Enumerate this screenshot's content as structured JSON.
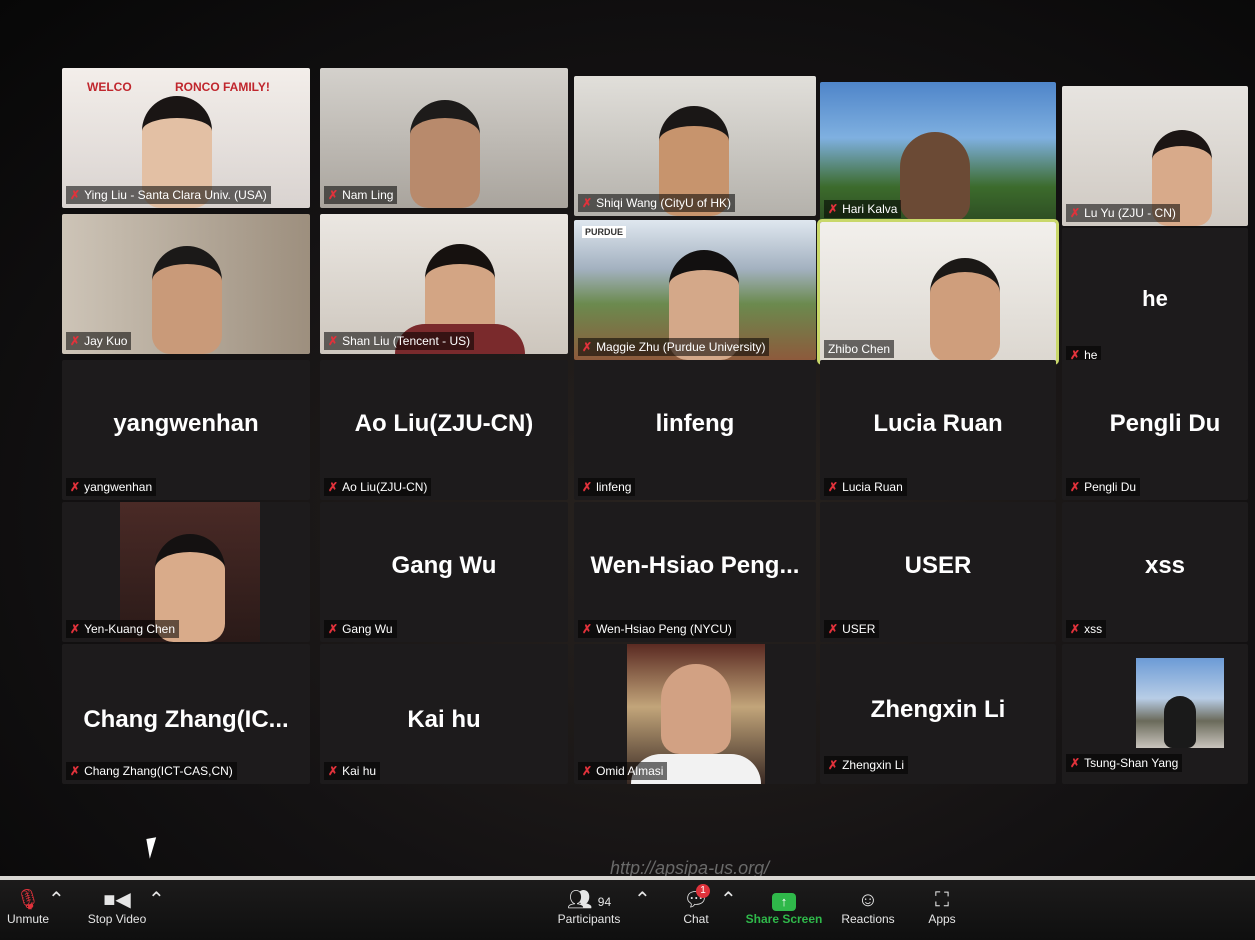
{
  "app": {
    "name": "Zoom meeting"
  },
  "tiles": [
    {
      "name": "Ying Liu - Santa Clara Univ. (USA)",
      "banner": "WELCO             RONCO FAMILY!"
    },
    {
      "name": "Nam Ling"
    },
    {
      "name": "Shiqi Wang (CityU of HK)"
    },
    {
      "name": "Hari Kalva"
    },
    {
      "name": "Lu Yu (ZJU - CN)"
    },
    {
      "name": "Jay Kuo"
    },
    {
      "name": "Shan Liu (Tencent - US)"
    },
    {
      "name": "Maggie Zhu (Purdue University)",
      "logo": "PURDUE"
    },
    {
      "name": "Zhibo Chen"
    },
    {
      "name": "he",
      "display": "he"
    },
    {
      "name": "yangwenhan",
      "display": "yangwenhan"
    },
    {
      "name": "Ao Liu(ZJU-CN)",
      "display": "Ao Liu(ZJU-CN)"
    },
    {
      "name": "linfeng",
      "display": "linfeng"
    },
    {
      "name": "Lucia Ruan",
      "display": "Lucia Ruan"
    },
    {
      "name": "Pengli Du",
      "display": "Pengli Du"
    },
    {
      "name": "Yen-Kuang Chen"
    },
    {
      "name": "Gang Wu",
      "display": "Gang Wu"
    },
    {
      "name": "Wen-Hsiao Peng (NYCU)",
      "display": "Wen-Hsiao  Peng..."
    },
    {
      "name": "USER",
      "display": "USER"
    },
    {
      "name": "xss",
      "display": "xss"
    },
    {
      "name": "Chang Zhang(ICT-CAS,CN)",
      "display": "Chang  Zhang(IC..."
    },
    {
      "name": "Kai  hu",
      "display": "Kai  hu"
    },
    {
      "name": "Omid Almasi"
    },
    {
      "name": "Zhengxin Li",
      "display": "Zhengxin Li"
    },
    {
      "name": "Tsung-Shan Yang"
    }
  ],
  "url_text": "http://apsipa-us.org/",
  "toolbar": {
    "unmute_label": "Unmute",
    "stop_video_label": "Stop Video",
    "participants_count": "94",
    "participants_label": "Participants",
    "chat_label": "Chat",
    "chat_badge": "1",
    "share_label": "Share Screen",
    "reactions_label": "Reactions",
    "apps_label": "Apps"
  },
  "colors": {
    "muted": "#e0323b",
    "share": "#2fb84a",
    "active_speaker": "#c9d86a"
  }
}
